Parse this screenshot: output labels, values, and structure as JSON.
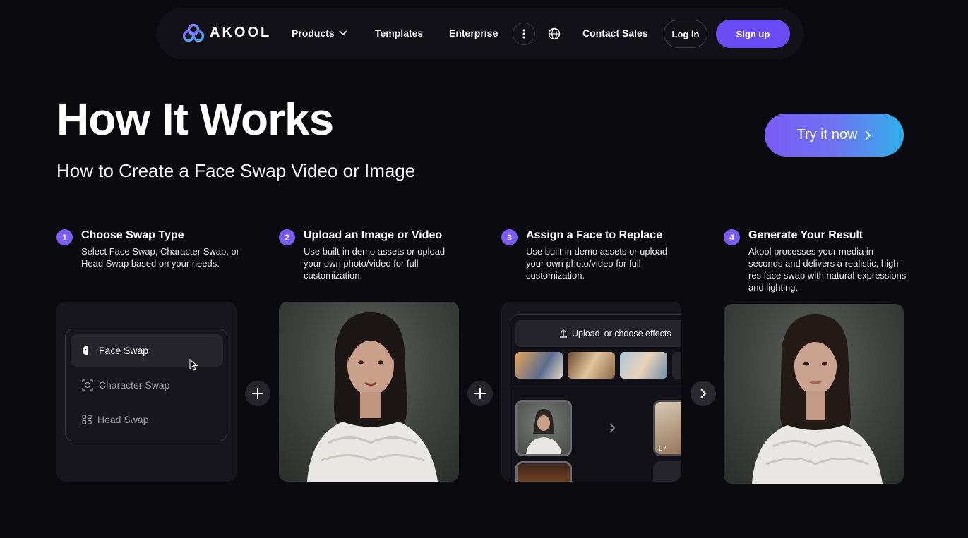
{
  "nav": {
    "brand": "AKOOL",
    "products": "Products",
    "templates": "Templates",
    "enterprise": "Enterprise",
    "contact": "Contact Sales",
    "login": "Log in",
    "signup": "Sign up"
  },
  "hero": {
    "title": "How It Works",
    "subtitle": "How to Create a Face Swap Video or Image",
    "cta": "Try it now"
  },
  "steps": [
    {
      "num": "1",
      "title": "Choose Swap Type",
      "desc": "Select Face Swap, Character Swap, or Head Swap based on your needs."
    },
    {
      "num": "2",
      "title": "Upload an Image or Video",
      "desc": "Use built-in demo assets or upload your own photo/video for full customization."
    },
    {
      "num": "3",
      "title": "Assign a Face to Replace",
      "desc": "Use built-in demo assets or upload your own photo/video for full customization."
    },
    {
      "num": "4",
      "title": "Generate Your Result",
      "desc": "Akool processes your media in seconds and delivers a realistic, high-res face swap with natural expressions and lighting."
    }
  ],
  "swap_menu": {
    "face": "Face Swap",
    "character": "Character Swap",
    "head": "Head Swap"
  },
  "assign_ui": {
    "upload": "Upload",
    "choose": "or choose effects",
    "badge": "07"
  },
  "colors": {
    "accent": "#6a4cf5",
    "step_badge": "#7b5cf6",
    "background": "#0b0a0f"
  }
}
